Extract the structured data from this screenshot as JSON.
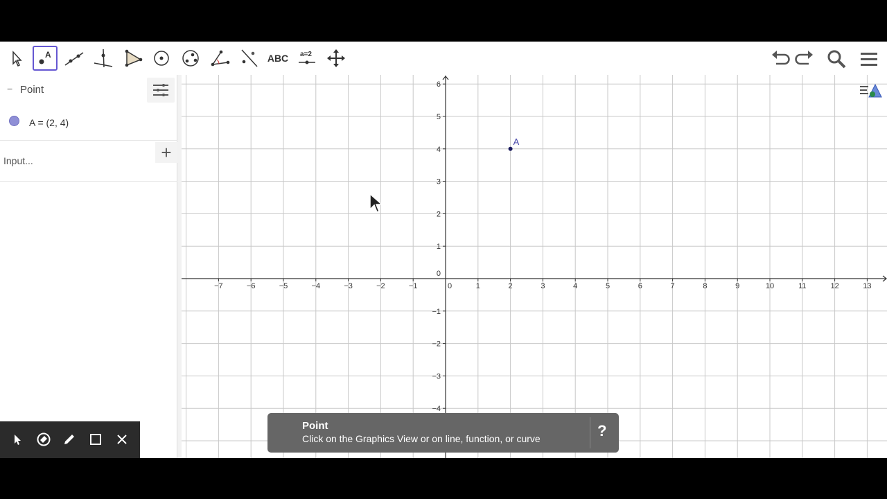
{
  "toolbar": {
    "tools": [
      {
        "icon": "move-arrow-icon",
        "selected": false
      },
      {
        "icon": "point-icon",
        "selected": true
      },
      {
        "icon": "line-icon",
        "selected": false
      },
      {
        "icon": "perpendicular-line-icon",
        "selected": false
      },
      {
        "icon": "polygon-icon",
        "selected": false
      },
      {
        "icon": "circle-center-point-icon",
        "selected": false
      },
      {
        "icon": "ellipse-icon",
        "selected": false
      },
      {
        "icon": "angle-icon",
        "selected": false
      },
      {
        "icon": "reflect-icon",
        "selected": false
      },
      {
        "icon": "text-icon",
        "label": "ABC",
        "selected": false
      },
      {
        "icon": "slider-icon",
        "label": "a=2",
        "selected": false
      },
      {
        "icon": "move-graphics-view-icon",
        "selected": false
      }
    ],
    "right": [
      "undo-icon",
      "redo-icon",
      "search-icon",
      "main-menu-icon"
    ]
  },
  "algebra": {
    "category_label": "Point",
    "items": [
      {
        "expression": "A = (2, 4)"
      }
    ],
    "input_placeholder": "Input..."
  },
  "graphics": {
    "x_ticks": [
      "−7",
      "−6",
      "−5",
      "−4",
      "−3",
      "−2",
      "−1",
      "0",
      "1",
      "2",
      "3",
      "4",
      "5",
      "6",
      "7",
      "8",
      "9",
      "10",
      "11",
      "12",
      "13"
    ],
    "y_ticks": [
      "6",
      "5",
      "4",
      "3",
      "2",
      "1",
      "0",
      "−1",
      "−2",
      "−3",
      "−4"
    ],
    "point": {
      "label": "A",
      "x": 2,
      "y": 4,
      "color": "#1a1a5e"
    },
    "grid_color": "#c8c8c8",
    "axis_color": "#333333"
  },
  "tooltip": {
    "title": "Point",
    "description": "Click on the Graphics View or on line, function, or curve",
    "help": "?"
  },
  "pen_toolbar": [
    "pen-move-icon",
    "eraser-icon",
    "pen-icon",
    "select-rectangle-icon",
    "close-icon"
  ],
  "colors": {
    "selected_tool": "#6557d2",
    "point_fill": "#8f8fd6"
  }
}
